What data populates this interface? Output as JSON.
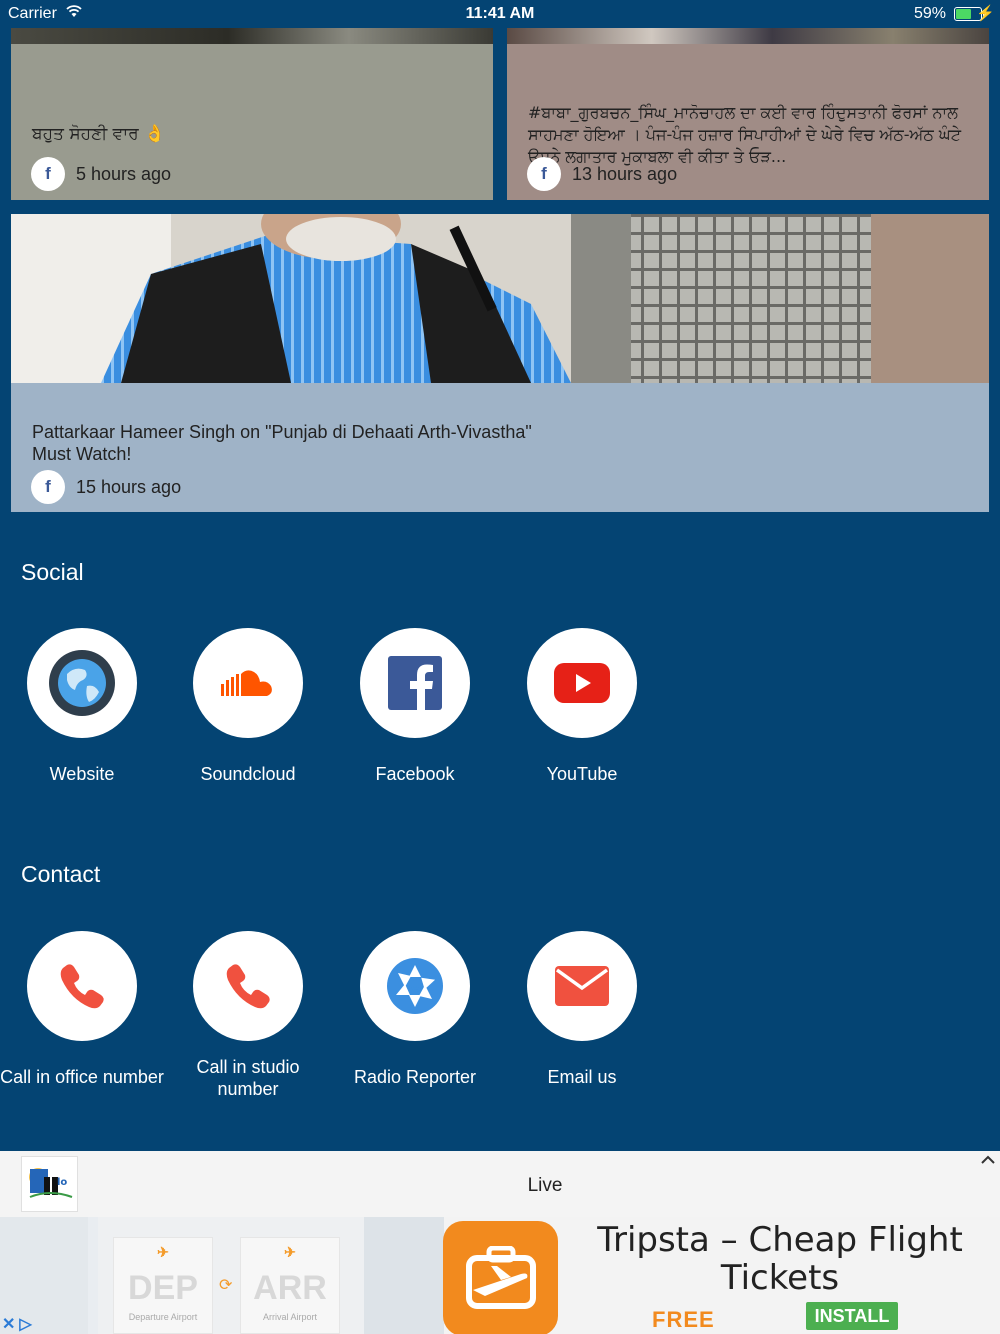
{
  "status_bar": {
    "carrier": "Carrier",
    "time": "11:41 AM",
    "battery": "59%"
  },
  "feed": {
    "cards": [
      {
        "text": "ਬਹੁਤ ਸੋਹਣੀ ਵਾਰ 👌",
        "source_icon": "facebook-icon",
        "time": "5 hours ago"
      },
      {
        "text": "#ਬਾਬਾ_ਗੁਰਬਚਨ_ਸਿੰਘ_ਮਾਨੋਚਾਹਲ ਦਾ ਕਈ ਵਾਰ ਹਿੰਦੁਸਤਾਨੀ ਫੋਰਸਾਂ ਨਾਲ ਸਾਹਮਣਾ ਹੋਇਆ । ਪੰਜ-ਪੰਜ ਹਜ਼ਾਰ ਸਿਪਾਹੀਆਂ ਦੇ ਘੇਰੇ ਵਿਚ ਅੱਠ-ਅੱਠ ਘੰਟੇ ਉਸਨੇ ਲਗਾਤਾਰ ਮੁਕਾਬਲਾ ਵੀ ਕੀਤਾ ਤੇ ਓੜ...",
        "source_icon": "facebook-icon",
        "time": "13 hours ago"
      },
      {
        "text_line1": "Pattarkaar Hameer Singh on \"Punjab di Dehaati Arth-Vivastha\"",
        "text_line2": "Must Watch!",
        "source_icon": "facebook-icon",
        "time": "15 hours ago"
      }
    ]
  },
  "social": {
    "title": "Social",
    "items": [
      {
        "label": "Website",
        "icon": "globe-icon"
      },
      {
        "label": "Soundcloud",
        "icon": "soundcloud-icon"
      },
      {
        "label": "Facebook",
        "icon": "facebook-icon"
      },
      {
        "label": "YouTube",
        "icon": "youtube-icon"
      }
    ]
  },
  "contact": {
    "title": "Contact",
    "items": [
      {
        "label": "Call in office number",
        "icon": "phone-icon"
      },
      {
        "label": "Call in studio number",
        "icon": "phone-icon"
      },
      {
        "label": "Radio Reporter",
        "icon": "camera-aperture-icon"
      },
      {
        "label": "Email us",
        "icon": "envelope-icon"
      }
    ]
  },
  "player": {
    "status": "Live",
    "expand_icon": "chevron-up-icon"
  },
  "ad": {
    "screenshot_left": "DEP",
    "screenshot_left_sub": "Departure Airport",
    "screenshot_right": "ARR",
    "screenshot_right_sub": "Arrival Airport",
    "title": "Tripsta – Cheap Flight Tickets",
    "price": "FREE",
    "cta": "INSTALL",
    "colors": {
      "accent": "#f28a1e",
      "cta": "#4caf50"
    }
  },
  "colors": {
    "background": "#044473",
    "social_soundcloud": "#ff5500",
    "social_facebook": "#3b5998",
    "social_youtube": "#e62117",
    "contact_accent": "#f0513f",
    "reporter_blue": "#3b8fe0"
  }
}
